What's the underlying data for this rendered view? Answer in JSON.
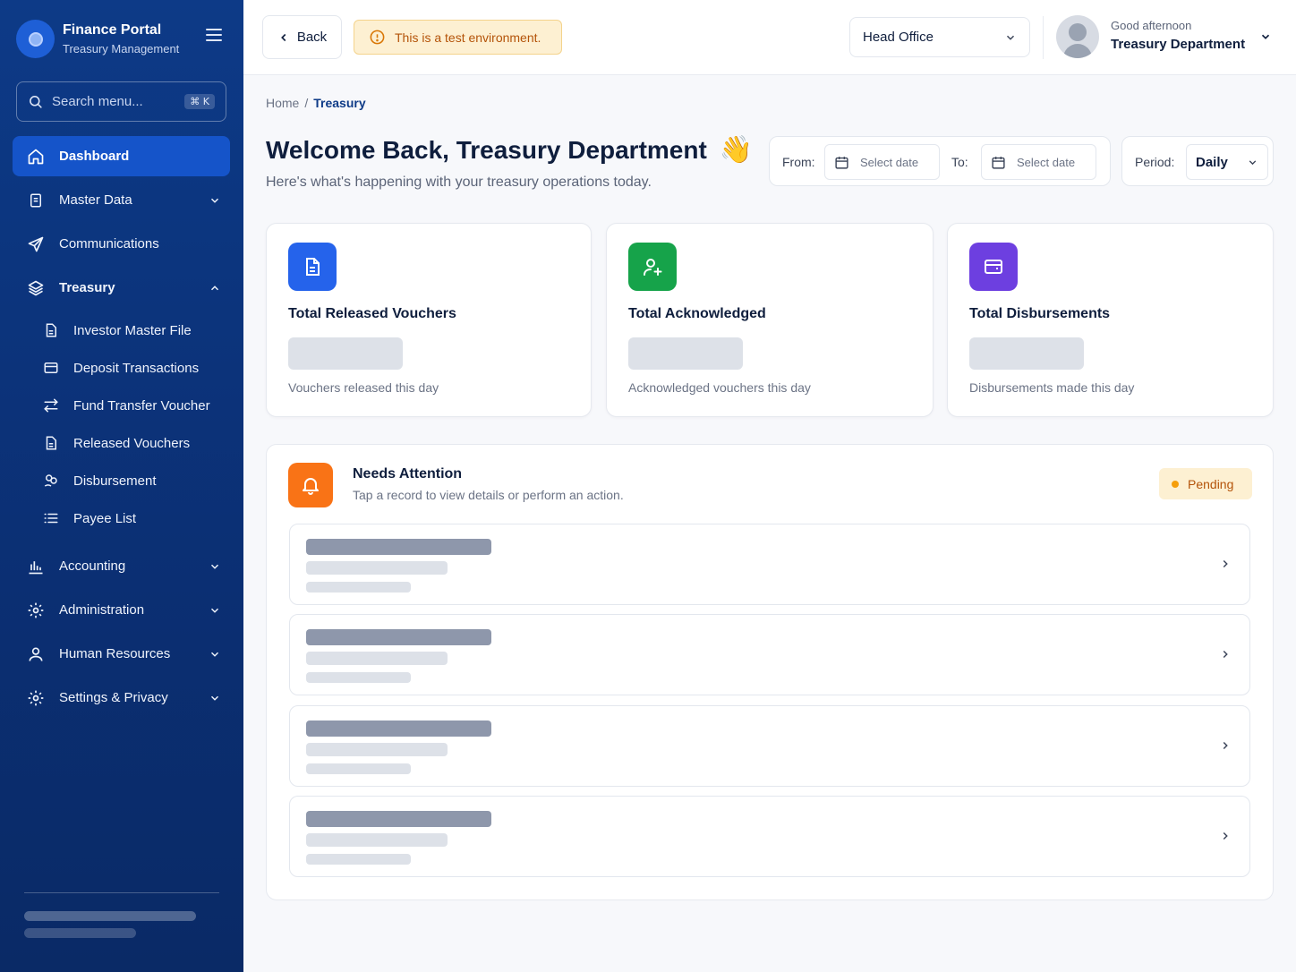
{
  "sidebar": {
    "brand_title": "Finance Portal",
    "brand_subtitle": "Treasury Management",
    "search_placeholder": "Search menu...",
    "search_shortcut": "⌘ K",
    "items": [
      {
        "label": "Dashboard",
        "icon": "home-icon",
        "active": true
      },
      {
        "label": "Master Data",
        "icon": "document-icon",
        "expandable": true
      },
      {
        "label": "Communications",
        "icon": "send-icon"
      },
      {
        "label": "Treasury",
        "icon": "layers-icon",
        "expanded": true
      },
      {
        "label": "Accounting",
        "icon": "bar-chart-icon",
        "expandable": true
      },
      {
        "label": "Administration",
        "icon": "gear-icon",
        "expandable": true
      },
      {
        "label": "Human Resources",
        "icon": "user-icon",
        "expandable": true
      },
      {
        "label": "Settings & Privacy",
        "icon": "gear-icon",
        "expandable": true
      }
    ],
    "treasury_subitems": [
      {
        "label": "Investor Master File",
        "icon": "file-icon"
      },
      {
        "label": "Deposit Transactions",
        "icon": "card-icon"
      },
      {
        "label": "Fund Transfer Voucher",
        "icon": "transfer-icon"
      },
      {
        "label": "Released Vouchers",
        "icon": "file-icon"
      },
      {
        "label": "Disbursement",
        "icon": "hand-coins-icon"
      },
      {
        "label": "Payee List",
        "icon": "list-icon"
      }
    ]
  },
  "topbar": {
    "back_label": "Back",
    "test_banner": "This is a test environment.",
    "office": "Head Office",
    "greeting": "Good afternoon",
    "user_name": "Treasury Department"
  },
  "breadcrumb": {
    "home": "Home",
    "separator": "/",
    "current": "Treasury"
  },
  "welcome": {
    "title": "Welcome Back, Treasury Department",
    "emoji": "👋",
    "subtitle": "Here's what's happening with your treasury operations today."
  },
  "filters": {
    "from_label": "From:",
    "to_label": "To:",
    "date_placeholder": "Select date",
    "period_label": "Period:",
    "period_value": "Daily"
  },
  "stats": [
    {
      "title": "Total Released Vouchers",
      "desc": "Vouchers released this day",
      "color": "#2563eb",
      "icon": "document-icon"
    },
    {
      "title": "Total Acknowledged",
      "desc": "Acknowledged vouchers this day",
      "color": "#16a34a",
      "icon": "user-plus-icon"
    },
    {
      "title": "Total Disbursements",
      "desc": "Disbursements made this day",
      "color": "#6d3fe0",
      "icon": "wallet-icon"
    }
  ],
  "attention": {
    "title": "Needs Attention",
    "subtitle": "Tap a record to view details or perform an action.",
    "badge": "Pending"
  },
  "colors": {
    "sidebar": "#0d3a87",
    "accent": "#1554c9",
    "warning_bg": "#fdf0d2",
    "warning_text": "#b45309"
  }
}
